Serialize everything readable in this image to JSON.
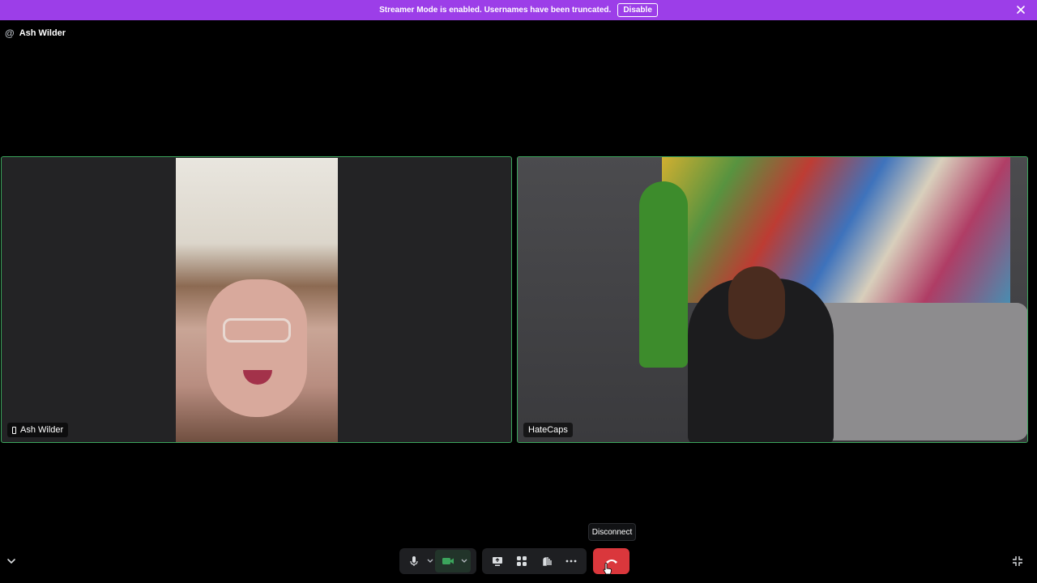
{
  "banner": {
    "message": "Streamer Mode is enabled. Usernames have been truncated.",
    "disable_label": "Disable",
    "close_icon": "close-icon",
    "color": "#9c3ee8"
  },
  "header": {
    "at_symbol": "@",
    "title": "Ash Wilder"
  },
  "participants": [
    {
      "name": "Ash Wilder",
      "device_icon": "mobile-icon"
    },
    {
      "name": "HateCaps"
    }
  ],
  "controls": {
    "tooltip": "Disconnect",
    "icons": {
      "mic": "microphone-icon",
      "mic_options": "chevron-down-icon",
      "camera": "video-camera-icon",
      "camera_options": "chevron-down-icon",
      "screen_share": "screen-share-icon",
      "activities": "activities-icon",
      "soundboard": "soundboard-icon",
      "more": "more-icon",
      "disconnect": "hang-up-icon",
      "collapse": "chevron-down-icon",
      "fullscreen": "exit-fullscreen-icon"
    },
    "colors": {
      "disconnect": "#da373c",
      "camera_active": "#3ba55c",
      "speaking_border": "#3ba55c"
    }
  }
}
